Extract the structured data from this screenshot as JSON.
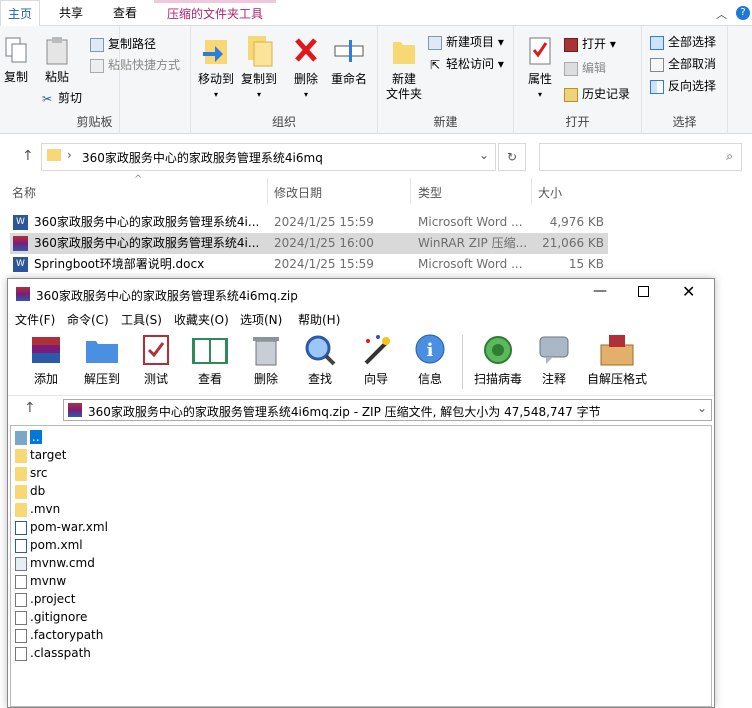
{
  "ribbon_tabs": [
    {
      "label": "主页"
    },
    {
      "label": "共享"
    },
    {
      "label": "查看"
    },
    {
      "label": "压缩的文件夹工具"
    }
  ],
  "ribbon": {
    "clipboard": {
      "label": "剪贴板",
      "copy": "复制",
      "paste": "粘贴",
      "copy_path": "复制路径",
      "paste_shortcut": "粘贴快捷方式",
      "cut": "剪切"
    },
    "organize": {
      "label": "组织",
      "move_to": "移动到",
      "copy_to": "复制到",
      "delete": "删除",
      "rename": "重命名"
    },
    "new": {
      "label": "新建",
      "new_item": "新建项目",
      "easy_access": "轻松访问",
      "new_folder": "新建\n文件夹"
    },
    "open": {
      "label": "打开",
      "open": "打开",
      "edit": "编辑",
      "history": "历史记录",
      "properties": "属性"
    },
    "select": {
      "label": "选择",
      "select_all": "全部选择",
      "select_none": "全部取消",
      "invert": "反向选择"
    }
  },
  "address": {
    "path": "360家政服务中心的家政服务管理系统4i6mq"
  },
  "columns": [
    "名称",
    "修改日期",
    "类型",
    "大小"
  ],
  "files": [
    {
      "name": "360家政服务中心的家政服务管理系统4i...",
      "date": "2024/1/25 15:59",
      "type": "Microsoft Word ...",
      "size": "4,976 KB"
    },
    {
      "name": "360家政服务中心的家政服务管理系统4i...",
      "date": "2024/1/25 16:00",
      "type": "WinRAR ZIP 压缩...",
      "size": "21,066 KB"
    },
    {
      "name": "Springboot环境部署说明.docx",
      "date": "2024/1/25 15:59",
      "type": "Microsoft Word ...",
      "size": "15 KB"
    }
  ],
  "rar": {
    "title": "360家政服务中心的家政服务管理系统4i6mq.zip",
    "menu": [
      "文件(F)",
      "命令(C)",
      "工具(S)",
      "收藏夹(O)",
      "选项(N)",
      "帮助(H)"
    ],
    "toolbar": [
      "添加",
      "解压到",
      "测试",
      "查看",
      "删除",
      "查找",
      "向导",
      "信息",
      "扫描病毒",
      "注释",
      "自解压格式"
    ],
    "path": "360家政服务中心的家政服务管理系统4i6mq.zip - ZIP 压缩文件, 解包大小为 47,548,747 字节",
    "items": [
      {
        "name": "..",
        "kind": "up"
      },
      {
        "name": "target",
        "kind": "folder"
      },
      {
        "name": "src",
        "kind": "folder"
      },
      {
        "name": "db",
        "kind": "folder"
      },
      {
        "name": ".mvn",
        "kind": "folder"
      },
      {
        "name": "pom-war.xml",
        "kind": "xml"
      },
      {
        "name": "pom.xml",
        "kind": "xml"
      },
      {
        "name": "mvnw.cmd",
        "kind": "cmd"
      },
      {
        "name": "mvnw",
        "kind": "file"
      },
      {
        "name": ".project",
        "kind": "file"
      },
      {
        "name": ".gitignore",
        "kind": "file"
      },
      {
        "name": ".factorypath",
        "kind": "file"
      },
      {
        "name": ".classpath",
        "kind": "file"
      }
    ]
  }
}
